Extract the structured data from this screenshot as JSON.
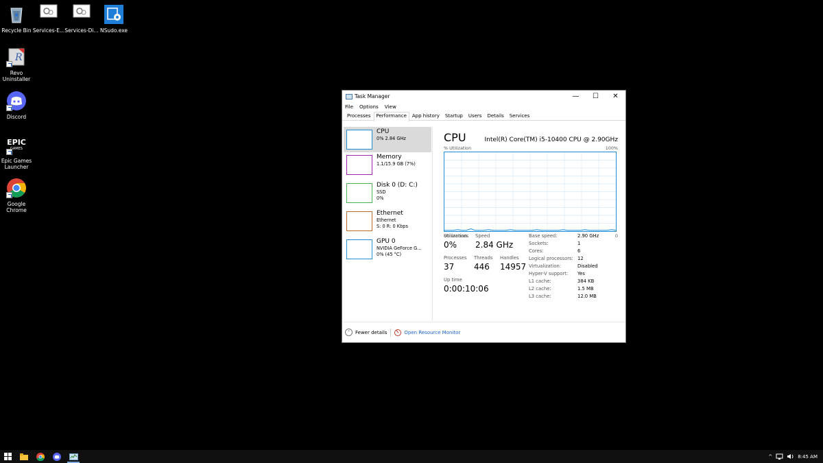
{
  "desktop": {
    "icons": [
      {
        "label": "Recycle Bin"
      },
      {
        "label": "Services-E..."
      },
      {
        "label": "Services-Di..."
      },
      {
        "label": "NSudo.exe"
      },
      {
        "label": "Revo Uninstaller"
      },
      {
        "label": "Discord"
      },
      {
        "label": "Epic Games Launcher",
        "logo_text": "EPIC GAMES"
      },
      {
        "label": "Google Chrome"
      }
    ]
  },
  "task_manager": {
    "title": "Task Manager",
    "window_buttons": {
      "minimize": "—",
      "maximize": "☐",
      "close": "✕"
    },
    "menu": [
      "File",
      "Options",
      "View"
    ],
    "tabs": [
      "Processes",
      "Performance",
      "App history",
      "Startup",
      "Users",
      "Details",
      "Services"
    ],
    "active_tab": "Performance",
    "sidebar": [
      {
        "name": "CPU",
        "line1": "0% 2.84 GHz",
        "line2": "",
        "color": "#1e8fd6"
      },
      {
        "name": "Memory",
        "line1": "1.1/15.9 GB (7%)",
        "line2": "",
        "color": "#9c27b0"
      },
      {
        "name": "Disk 0 (D: C:)",
        "line1": "SSD",
        "line2": "0%",
        "color": "#4caf50"
      },
      {
        "name": "Ethernet",
        "line1": "Ethernet",
        "line2": "S: 0 R: 0 Kbps",
        "color": "#b86a2a"
      },
      {
        "name": "GPU 0",
        "line1": "NVIDIA GeForce G...",
        "line2": "0% (45 °C)",
        "color": "#1e8fd6"
      }
    ],
    "main": {
      "title": "CPU",
      "cpu_name": "Intel(R) Core(TM) i5-10400 CPU @ 2.90GHz",
      "util_label": "% Utilization",
      "util_max": "100%",
      "time_label": "60 seconds",
      "axis_min": "0",
      "utilization_label": "Utilization",
      "utilization": "0%",
      "speed_label": "Speed",
      "speed": "2.84 GHz",
      "processes_label": "Processes",
      "processes": "37",
      "threads_label": "Threads",
      "threads": "446",
      "handles_label": "Handles",
      "handles": "14957",
      "uptime_label": "Up time",
      "uptime": "0:00:10:06",
      "specs": [
        {
          "key": "Base speed:",
          "value": "2.90 GHz"
        },
        {
          "key": "Sockets:",
          "value": "1"
        },
        {
          "key": "Cores:",
          "value": "6"
        },
        {
          "key": "Logical processors:",
          "value": "12"
        },
        {
          "key": "Virtualization:",
          "value": "Disabled"
        },
        {
          "key": "Hyper-V support:",
          "value": "Yes"
        },
        {
          "key": "L1 cache:",
          "value": "384 KB"
        },
        {
          "key": "L2 cache:",
          "value": "1.5 MB"
        },
        {
          "key": "L3 cache:",
          "value": "12.0 MB"
        }
      ],
      "graph_series": [
        1,
        1,
        1,
        2,
        1,
        1,
        3,
        1,
        1,
        1,
        2,
        1,
        1,
        1,
        1,
        2,
        1,
        1,
        1,
        1,
        1,
        2,
        1,
        1,
        1,
        1,
        1,
        2,
        1,
        1,
        1,
        1,
        2,
        1,
        1,
        1,
        1,
        1,
        2,
        1
      ]
    },
    "footer": {
      "fewer_details": "Fewer details",
      "open_resource_monitor": "Open Resource Monitor"
    }
  },
  "taskbar": {
    "time": "8:45 AM",
    "tray_icons": [
      "chevron-up",
      "network",
      "volume"
    ]
  }
}
